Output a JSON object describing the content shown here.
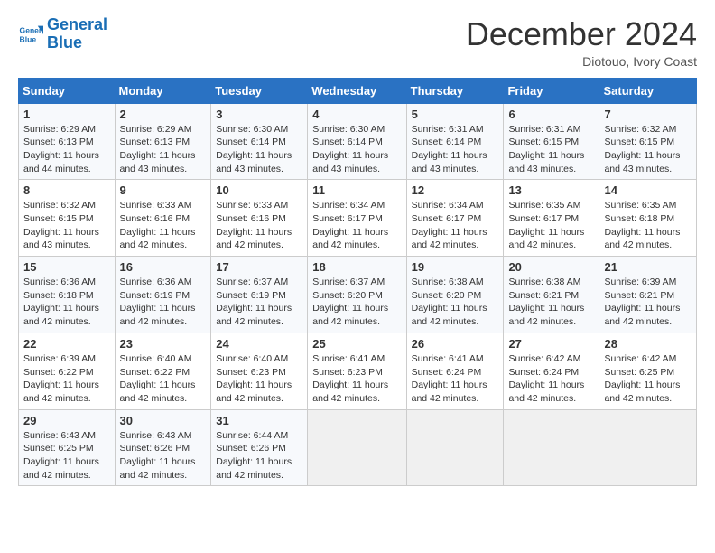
{
  "logo": {
    "line1": "General",
    "line2": "Blue"
  },
  "title": "December 2024",
  "location": "Diotouo, Ivory Coast",
  "headers": [
    "Sunday",
    "Monday",
    "Tuesday",
    "Wednesday",
    "Thursday",
    "Friday",
    "Saturday"
  ],
  "weeks": [
    [
      {
        "day": "1",
        "sunrise": "6:29 AM",
        "sunset": "6:13 PM",
        "daylight": "11 hours and 44 minutes."
      },
      {
        "day": "2",
        "sunrise": "6:29 AM",
        "sunset": "6:13 PM",
        "daylight": "11 hours and 43 minutes."
      },
      {
        "day": "3",
        "sunrise": "6:30 AM",
        "sunset": "6:14 PM",
        "daylight": "11 hours and 43 minutes."
      },
      {
        "day": "4",
        "sunrise": "6:30 AM",
        "sunset": "6:14 PM",
        "daylight": "11 hours and 43 minutes."
      },
      {
        "day": "5",
        "sunrise": "6:31 AM",
        "sunset": "6:14 PM",
        "daylight": "11 hours and 43 minutes."
      },
      {
        "day": "6",
        "sunrise": "6:31 AM",
        "sunset": "6:15 PM",
        "daylight": "11 hours and 43 minutes."
      },
      {
        "day": "7",
        "sunrise": "6:32 AM",
        "sunset": "6:15 PM",
        "daylight": "11 hours and 43 minutes."
      }
    ],
    [
      {
        "day": "8",
        "sunrise": "6:32 AM",
        "sunset": "6:15 PM",
        "daylight": "11 hours and 43 minutes."
      },
      {
        "day": "9",
        "sunrise": "6:33 AM",
        "sunset": "6:16 PM",
        "daylight": "11 hours and 42 minutes."
      },
      {
        "day": "10",
        "sunrise": "6:33 AM",
        "sunset": "6:16 PM",
        "daylight": "11 hours and 42 minutes."
      },
      {
        "day": "11",
        "sunrise": "6:34 AM",
        "sunset": "6:17 PM",
        "daylight": "11 hours and 42 minutes."
      },
      {
        "day": "12",
        "sunrise": "6:34 AM",
        "sunset": "6:17 PM",
        "daylight": "11 hours and 42 minutes."
      },
      {
        "day": "13",
        "sunrise": "6:35 AM",
        "sunset": "6:17 PM",
        "daylight": "11 hours and 42 minutes."
      },
      {
        "day": "14",
        "sunrise": "6:35 AM",
        "sunset": "6:18 PM",
        "daylight": "11 hours and 42 minutes."
      }
    ],
    [
      {
        "day": "15",
        "sunrise": "6:36 AM",
        "sunset": "6:18 PM",
        "daylight": "11 hours and 42 minutes."
      },
      {
        "day": "16",
        "sunrise": "6:36 AM",
        "sunset": "6:19 PM",
        "daylight": "11 hours and 42 minutes."
      },
      {
        "day": "17",
        "sunrise": "6:37 AM",
        "sunset": "6:19 PM",
        "daylight": "11 hours and 42 minutes."
      },
      {
        "day": "18",
        "sunrise": "6:37 AM",
        "sunset": "6:20 PM",
        "daylight": "11 hours and 42 minutes."
      },
      {
        "day": "19",
        "sunrise": "6:38 AM",
        "sunset": "6:20 PM",
        "daylight": "11 hours and 42 minutes."
      },
      {
        "day": "20",
        "sunrise": "6:38 AM",
        "sunset": "6:21 PM",
        "daylight": "11 hours and 42 minutes."
      },
      {
        "day": "21",
        "sunrise": "6:39 AM",
        "sunset": "6:21 PM",
        "daylight": "11 hours and 42 minutes."
      }
    ],
    [
      {
        "day": "22",
        "sunrise": "6:39 AM",
        "sunset": "6:22 PM",
        "daylight": "11 hours and 42 minutes."
      },
      {
        "day": "23",
        "sunrise": "6:40 AM",
        "sunset": "6:22 PM",
        "daylight": "11 hours and 42 minutes."
      },
      {
        "day": "24",
        "sunrise": "6:40 AM",
        "sunset": "6:23 PM",
        "daylight": "11 hours and 42 minutes."
      },
      {
        "day": "25",
        "sunrise": "6:41 AM",
        "sunset": "6:23 PM",
        "daylight": "11 hours and 42 minutes."
      },
      {
        "day": "26",
        "sunrise": "6:41 AM",
        "sunset": "6:24 PM",
        "daylight": "11 hours and 42 minutes."
      },
      {
        "day": "27",
        "sunrise": "6:42 AM",
        "sunset": "6:24 PM",
        "daylight": "11 hours and 42 minutes."
      },
      {
        "day": "28",
        "sunrise": "6:42 AM",
        "sunset": "6:25 PM",
        "daylight": "11 hours and 42 minutes."
      }
    ],
    [
      {
        "day": "29",
        "sunrise": "6:43 AM",
        "sunset": "6:25 PM",
        "daylight": "11 hours and 42 minutes."
      },
      {
        "day": "30",
        "sunrise": "6:43 AM",
        "sunset": "6:26 PM",
        "daylight": "11 hours and 42 minutes."
      },
      {
        "day": "31",
        "sunrise": "6:44 AM",
        "sunset": "6:26 PM",
        "daylight": "11 hours and 42 minutes."
      },
      null,
      null,
      null,
      null
    ]
  ]
}
